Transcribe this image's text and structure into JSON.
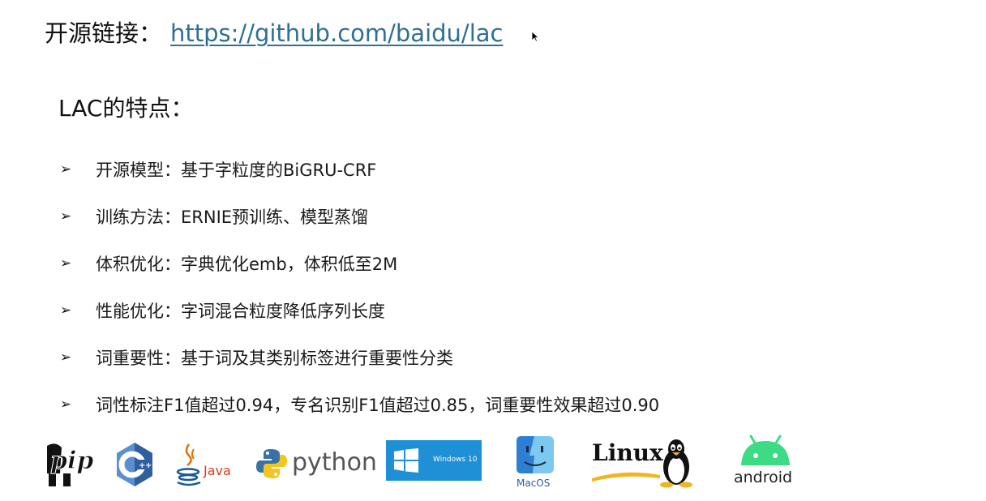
{
  "header": {
    "label": "开源链接：",
    "url": "https://github.com/baidu/lac"
  },
  "section_title": "LAC的特点：",
  "bullet_glyph": "➢",
  "features": [
    "开源模型：基于字粒度的BiGRU-CRF",
    "训练方法：ERNIE预训练、模型蒸馏",
    "体积优化：字典优化emb，体积低至2M",
    "性能优化：字词混合粒度降低序列长度",
    "词重要性：基于词及其类别标签进行重要性分类",
    "词性标注F1值超过0.94，专名识别F1值超过0.85，词重要性效果超过0.90"
  ],
  "logos": {
    "pip": "pip",
    "java": "Java",
    "python": "python",
    "windows": "Windows 10",
    "macos": "MacOS",
    "linux": "Linux",
    "android": "android"
  },
  "colors": {
    "link": "#2e6f95",
    "windows_bg": "#1f8fd6",
    "android_green": "#3ddc84",
    "cpp_blue": "#2f5f9e"
  },
  "icons": [
    "pip-logo-icon",
    "cpp-logo-icon",
    "java-logo-icon",
    "python-logo-icon",
    "windows-logo-icon",
    "macos-finder-icon",
    "linux-tux-icon",
    "android-logo-icon",
    "mouse-cursor-icon"
  ]
}
